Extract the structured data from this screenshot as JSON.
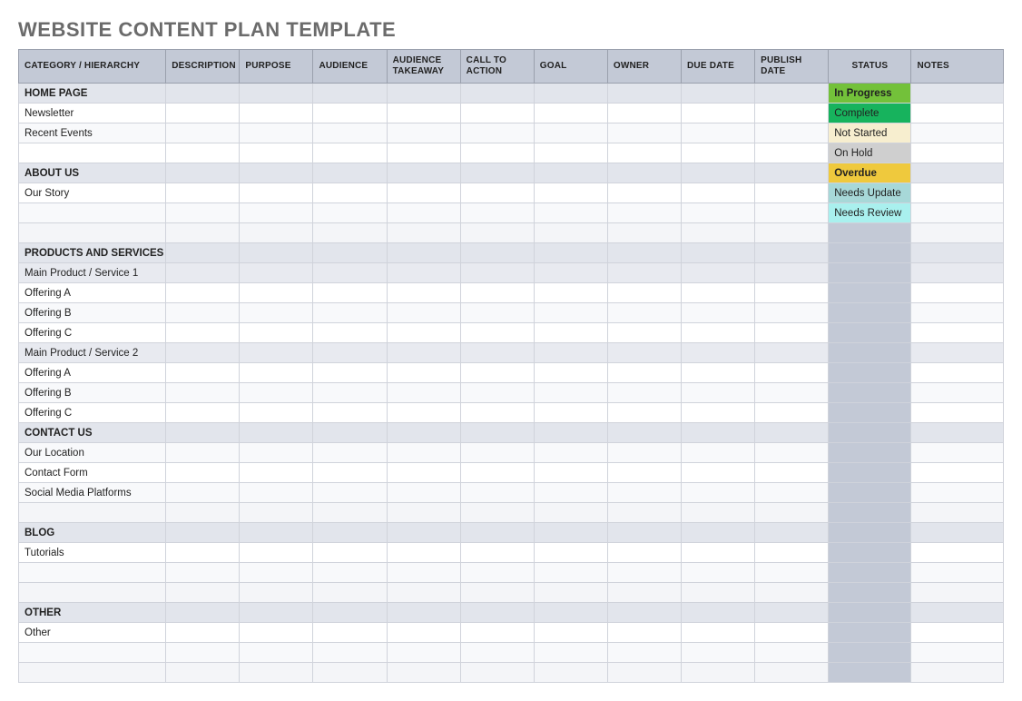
{
  "title": "WEBSITE CONTENT PLAN TEMPLATE",
  "columns": [
    "CATEGORY / HIERARCHY",
    "DESCRIPTION",
    "PURPOSE",
    "AUDIENCE",
    "AUDIENCE TAKEAWAY",
    "CALL TO ACTION",
    "GOAL",
    "OWNER",
    "DUE DATE",
    "PUBLISH DATE",
    "STATUS",
    "NOTES"
  ],
  "rows": [
    {
      "category": "HOME PAGE",
      "rowClass": "row-section",
      "status": "In Progress",
      "statusClass": "st-inprogress"
    },
    {
      "category": "Newsletter",
      "rowClass": "row-sub",
      "status": "Complete",
      "statusClass": "st-complete"
    },
    {
      "category": "Recent Events",
      "rowClass": "row-sub-alt",
      "status": "Not Started",
      "statusClass": "st-notstarted"
    },
    {
      "category": "",
      "rowClass": "row-sub",
      "status": "On Hold",
      "statusClass": "st-onhold"
    },
    {
      "category": "ABOUT US",
      "rowClass": "row-section",
      "status": "Overdue",
      "statusClass": "st-overdue"
    },
    {
      "category": "Our Story",
      "rowClass": "row-sub",
      "status": "Needs Update",
      "statusClass": "st-needsupd"
    },
    {
      "category": "",
      "rowClass": "row-sub-alt",
      "status": "Needs Review",
      "statusClass": "st-needsrev"
    },
    {
      "category": "",
      "rowClass": "row-light",
      "status": "",
      "statusClass": "st-blank-d"
    },
    {
      "category": "PRODUCTS AND SERVICES",
      "rowClass": "row-section",
      "status": "",
      "statusClass": "st-blank-d"
    },
    {
      "category": "Main Product / Service 1",
      "rowClass": "row-shade",
      "status": "",
      "statusClass": "st-blank-d"
    },
    {
      "category": "Offering A",
      "rowClass": "row-sub",
      "status": "",
      "statusClass": "st-blank-d"
    },
    {
      "category": "Offering B",
      "rowClass": "row-sub-alt",
      "status": "",
      "statusClass": "st-blank-d"
    },
    {
      "category": "Offering C",
      "rowClass": "row-sub",
      "status": "",
      "statusClass": "st-blank-d"
    },
    {
      "category": "Main Product / Service 2",
      "rowClass": "row-shade",
      "status": "",
      "statusClass": "st-blank-d"
    },
    {
      "category": "Offering A",
      "rowClass": "row-sub",
      "status": "",
      "statusClass": "st-blank-d"
    },
    {
      "category": "Offering B",
      "rowClass": "row-sub-alt",
      "status": "",
      "statusClass": "st-blank-d"
    },
    {
      "category": "Offering C",
      "rowClass": "row-sub",
      "status": "",
      "statusClass": "st-blank-d"
    },
    {
      "category": "CONTACT US",
      "rowClass": "row-section",
      "status": "",
      "statusClass": "st-blank-d"
    },
    {
      "category": "Our Location",
      "rowClass": "row-sub-alt",
      "status": "",
      "statusClass": "st-blank-d"
    },
    {
      "category": "Contact Form",
      "rowClass": "row-sub",
      "status": "",
      "statusClass": "st-blank-d"
    },
    {
      "category": "Social Media Platforms",
      "rowClass": "row-sub-alt",
      "status": "",
      "statusClass": "st-blank-d"
    },
    {
      "category": "",
      "rowClass": "row-light",
      "status": "",
      "statusClass": "st-blank-d"
    },
    {
      "category": "BLOG",
      "rowClass": "row-section",
      "status": "",
      "statusClass": "st-blank-d"
    },
    {
      "category": "Tutorials",
      "rowClass": "row-sub",
      "status": "",
      "statusClass": "st-blank-d"
    },
    {
      "category": "",
      "rowClass": "row-sub-alt",
      "status": "",
      "statusClass": "st-blank-d"
    },
    {
      "category": "",
      "rowClass": "row-light",
      "status": "",
      "statusClass": "st-blank-d"
    },
    {
      "category": "OTHER",
      "rowClass": "row-section",
      "status": "",
      "statusClass": "st-blank-d"
    },
    {
      "category": "Other",
      "rowClass": "row-sub",
      "status": "",
      "statusClass": "st-blank-d"
    },
    {
      "category": "",
      "rowClass": "row-sub-alt",
      "status": "",
      "statusClass": "st-blank-d"
    },
    {
      "category": "",
      "rowClass": "row-light",
      "status": "",
      "statusClass": "st-blank-d"
    }
  ]
}
